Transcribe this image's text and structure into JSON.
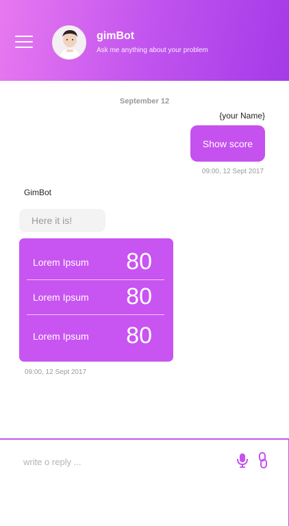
{
  "header": {
    "bot_name": "gimBot",
    "subtitle": "Ask me anything about your problem"
  },
  "chat": {
    "date_separator": "September 12",
    "user_message": {
      "sender": "{your Name}",
      "text": "Show score",
      "time": "09:00, 12 Sept 2017"
    },
    "bot_message": {
      "sender": "GimBot",
      "text": "Here it is!",
      "time": "09:00, 12 Sept 2017",
      "scores": [
        {
          "label": "Lorem Ipsum",
          "value": "80"
        },
        {
          "label": "Lorem Ipsum",
          "value": "80"
        },
        {
          "label": "Lorem Ipsum",
          "value": "80"
        }
      ]
    }
  },
  "composer": {
    "placeholder": "write o reply ..."
  },
  "colors": {
    "accent": "#c551ee",
    "header_start": "#e879f0",
    "header_end": "#a53ae8"
  },
  "icons": {
    "menu": "hamburger-menu-icon",
    "mic": "microphone-icon",
    "attach": "link-icon"
  }
}
